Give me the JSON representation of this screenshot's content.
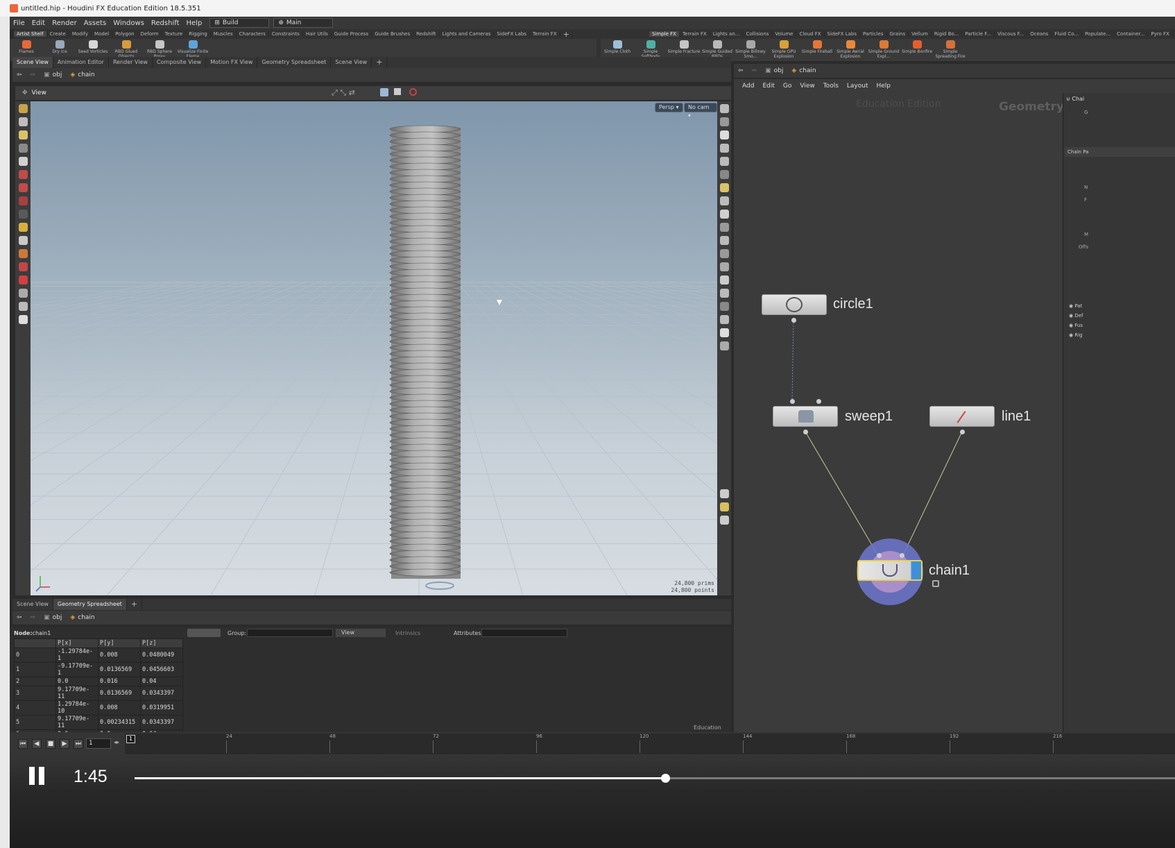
{
  "window": {
    "title": "untitled.hip - Houdini FX Education Edition 18.5.351"
  },
  "menu": {
    "items": [
      "File",
      "Edit",
      "Render",
      "Assets",
      "Windows",
      "Redshift",
      "Help"
    ],
    "desktop_combo": "Build",
    "context_combo": "Main"
  },
  "shelf_left": {
    "tabs": [
      "Artist Shelf",
      "Create",
      "Modify",
      "Model",
      "Polygon",
      "Deform",
      "Texture",
      "Rigging",
      "Muscles",
      "Characters",
      "Constraints",
      "Hair Utils",
      "Guide Process",
      "Guide Brushes",
      "Redshift",
      "Lights and Cameras",
      "SideFX Labs",
      "Terrain FX"
    ],
    "tools": [
      "Flames",
      "Dry Ice",
      "Seed Vorticles",
      "RBD Glued Objects",
      "RBD Sphere Proxy",
      "Visualize Finite Eleme"
    ]
  },
  "shelf_right": {
    "tabs": [
      "Simple FX",
      "Terrain FX",
      "Lights an...",
      "Collisions",
      "Volume",
      "Cloud FX",
      "SideFX Labs",
      "Particles",
      "Grains",
      "Vellum",
      "Rigid Bo...",
      "Particle F...",
      "Viscous F...",
      "Oceans",
      "Fluid Co...",
      "Populate...",
      "Container...",
      "Pyro FX"
    ],
    "tools": [
      "Simple Cloth",
      "Simple Softbody",
      "Simple Fracture",
      "Simple Guided RBDs",
      "Simple Billowy Smo...",
      "Simple GPU Explosion",
      "Simple Fireball",
      "Simple Aerial Explosion",
      "Simple Ground Expl...",
      "Simple Bonfire",
      "Simple Spreading Fire"
    ]
  },
  "pane_tabs_top": [
    "Scene View",
    "Animation Editor",
    "Render View",
    "Composite View",
    "Motion FX View",
    "Geometry Spreadsheet",
    "Scene View"
  ],
  "pane_tabs_bottom": [
    "Scene View",
    "Geometry Spreadsheet"
  ],
  "path": {
    "root": "obj",
    "node": "chain"
  },
  "viewport": {
    "label": "View",
    "persp": "Persp ▾",
    "cam": "No cam ▾",
    "prims": "24,800  prims",
    "points": "24,800 points"
  },
  "network": {
    "menu": [
      "Add",
      "Edit",
      "Go",
      "View",
      "Tools",
      "Layout",
      "Help"
    ],
    "watermark": "Education Edition",
    "context": "Geometry",
    "nodes": [
      "circle1",
      "sweep1",
      "line1",
      "chain1"
    ]
  },
  "params": {
    "header": "Chai",
    "tab": "Chain Pa",
    "labels": [
      "G",
      "N",
      "F",
      "M",
      "Offs"
    ],
    "radios": [
      "Pat",
      "Def",
      "Fus",
      "Rig"
    ]
  },
  "spreadsheet": {
    "node_label": "Node:",
    "node_name": "chain1",
    "group_label": "Group:",
    "view_label": "View",
    "intrinsics_label": "Intrinsics",
    "attributes_label": "Attributes:",
    "columns": [
      "P[x]",
      "P[y]",
      "P[z]"
    ],
    "rows": [
      [
        "0",
        "-1.29784e-1",
        "0.008",
        "0.0480049"
      ],
      [
        "1",
        "-9.17709e-1",
        "0.0136569",
        "0.0456603"
      ],
      [
        "2",
        "0.0",
        "0.016",
        "0.04"
      ],
      [
        "3",
        "9.17709e-11",
        "0.0136569",
        "0.0343397"
      ],
      [
        "4",
        "1.29784e-10",
        "0.008",
        "0.0319951"
      ],
      [
        "5",
        "9.17709e-11",
        "0.00234315",
        "0.0343397"
      ],
      [
        "6",
        "0.0",
        "0.0",
        "0.04"
      ],
      [
        "7",
        "-9.17709e-1",
        "0.00234315",
        "0.0456603"
      ]
    ],
    "footer": "Education"
  },
  "timeline": {
    "frame": "1",
    "marker": "1",
    "ticks": [
      "24",
      "48",
      "72",
      "96",
      "120",
      "144",
      "168",
      "192",
      "216"
    ]
  },
  "video": {
    "time": "1:45",
    "progress": 0.51
  },
  "colors": {
    "accent_orange": "#e8683a",
    "node_selected": "#3f8fdc",
    "chain_glow": "#6b74c8"
  }
}
